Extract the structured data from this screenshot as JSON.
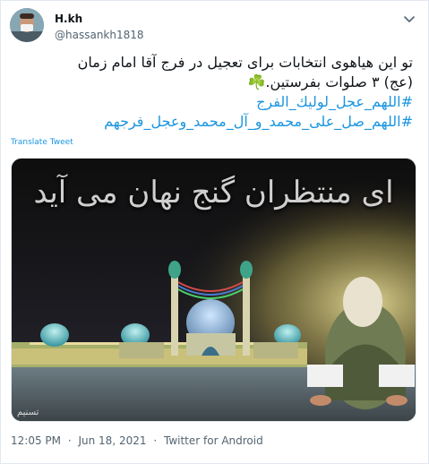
{
  "author": {
    "name": "H.kh",
    "handle": "@hassankh1818"
  },
  "tweet": {
    "line1": "تو این هیاهوی انتخابات برای تعجیل در فرج آقا امام زمان",
    "line2": "(عج) ۳ صلوات بفرستین.☘️",
    "hashtag1": "#اللهم_عجل_لوليك_الفرج",
    "hashtag2": "#اللهم_صل_علی_محمد_و_آل_محمد_وعجل_فرجهم",
    "translate_label": "Translate Tweet"
  },
  "media": {
    "overlay_text": "ای منتظران گنج نهان می آید",
    "signature": "تسنیم"
  },
  "footer": {
    "time": "12:05 PM",
    "separator1": "·",
    "date": "Jun 18, 2021",
    "separator2": "·",
    "client": "Twitter for Android"
  },
  "colors": {
    "link": "#1b95e0",
    "text": "#0f1419",
    "muted": "#536471"
  },
  "icons": {
    "more": "chevron-down-icon"
  }
}
